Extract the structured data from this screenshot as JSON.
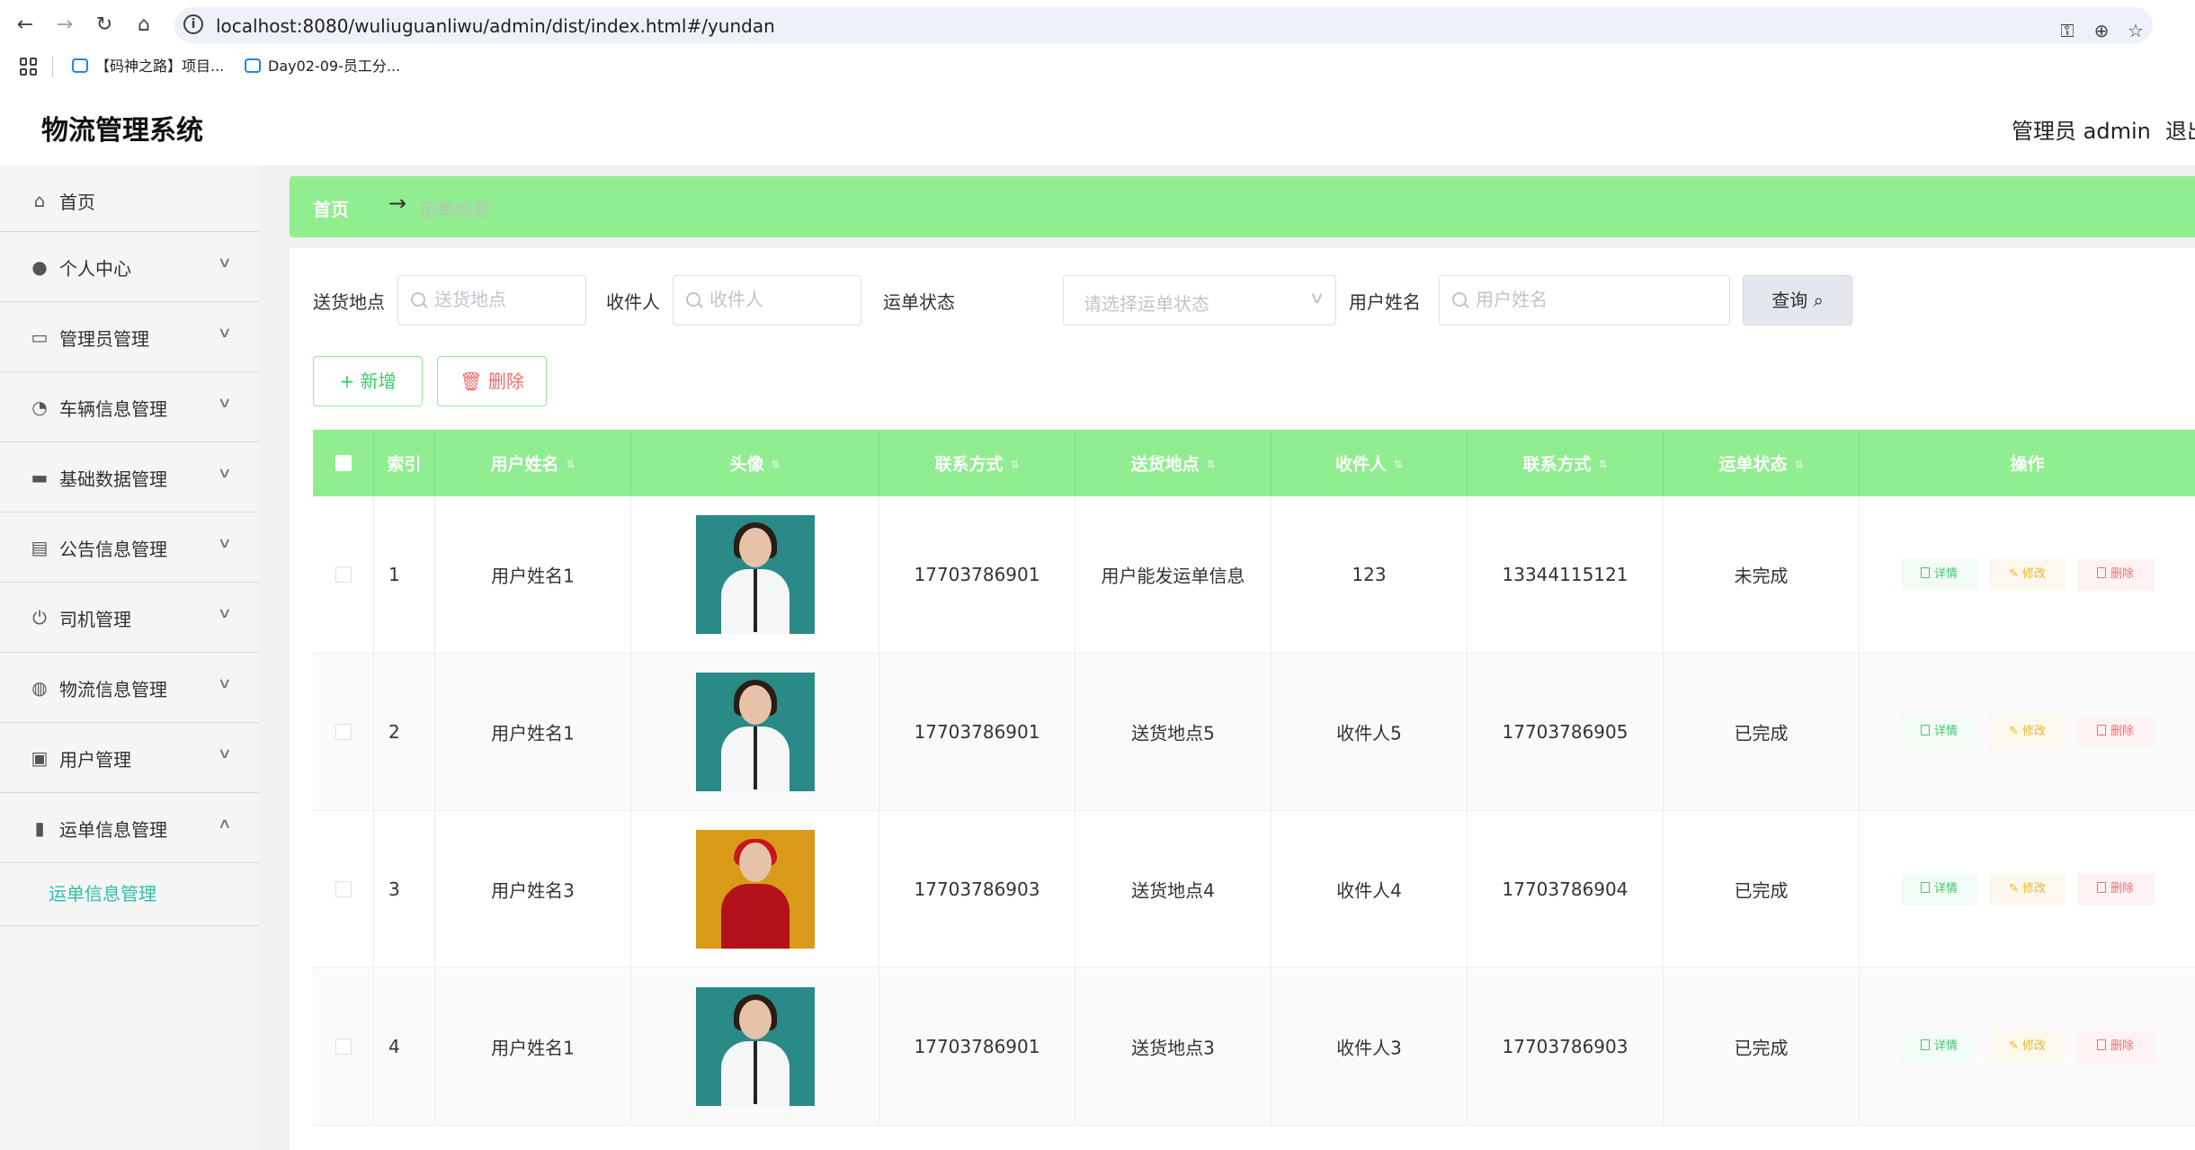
{
  "browser": {
    "url": "localhost:8080/wuliuguanliwu/admin/dist/index.html#/yundan",
    "bookmarks": [
      "【码神之路】项目...",
      "Day02-09-员工分..."
    ]
  },
  "app": {
    "title": "物流管理系统",
    "user": "管理员 admin",
    "logout": "退出"
  },
  "sidebar": {
    "items": [
      {
        "label": "首页",
        "icon": "home-icon"
      },
      {
        "label": "个人中心",
        "icon": "user-icon"
      },
      {
        "label": "管理员管理",
        "icon": "chat-icon"
      },
      {
        "label": "车辆信息管理",
        "icon": "gauge-icon"
      },
      {
        "label": "基础数据管理",
        "icon": "message-icon"
      },
      {
        "label": "公告信息管理",
        "icon": "clipboard-icon"
      },
      {
        "label": "司机管理",
        "icon": "power-icon"
      },
      {
        "label": "物流信息管理",
        "icon": "globe-icon"
      },
      {
        "label": "用户管理",
        "icon": "checklist-icon"
      },
      {
        "label": "运单信息管理",
        "icon": "bar-chart-icon"
      }
    ],
    "submenu": {
      "label": "运单信息管理"
    }
  },
  "breadcrumb": {
    "home": "首页",
    "current": "运单信息"
  },
  "search": {
    "address_label": "送货地点",
    "address_placeholder": "送货地点",
    "recipient_label": "收件人",
    "recipient_placeholder": "收件人",
    "status_label": "运单状态",
    "status_placeholder": "请选择运单状态",
    "username_label": "用户姓名",
    "username_placeholder": "用户姓名",
    "query_label": "查询"
  },
  "actions": {
    "add_label": "新增",
    "delete_label": "删除"
  },
  "table": {
    "columns": [
      "索引",
      "用户姓名",
      "头像",
      "联系方式",
      "送货地点",
      "收件人",
      "联系方式",
      "运单状态",
      "操作"
    ],
    "op_labels": {
      "detail": "详情",
      "edit": "修改",
      "remove": "删除"
    },
    "rows": [
      {
        "index": "1",
        "username": "用户姓名1",
        "phone": "17703786901",
        "address": "用户能发运单信息",
        "recipient": "123",
        "recipient_phone": "13344115121",
        "status": "未完成",
        "avatar": "woman-white-shirt"
      },
      {
        "index": "2",
        "username": "用户姓名1",
        "phone": "17703786901",
        "address": "送货地点5",
        "recipient": "收件人5",
        "recipient_phone": "17703786905",
        "status": "已完成",
        "avatar": "woman-white-shirt"
      },
      {
        "index": "3",
        "username": "用户姓名3",
        "phone": "17703786903",
        "address": "送货地点4",
        "recipient": "收件人4",
        "recipient_phone": "17703786904",
        "status": "已完成",
        "avatar": "woman-red-hat"
      },
      {
        "index": "4",
        "username": "用户姓名1",
        "phone": "17703786901",
        "address": "送货地点3",
        "recipient": "收件人3",
        "recipient_phone": "17703786903",
        "status": "已完成",
        "avatar": "woman-white-shirt"
      }
    ]
  },
  "colors": {
    "accent": "#90ee90",
    "submenu_active": "#2fc0a5",
    "danger": "#f56c6c",
    "warning": "#f0b429"
  }
}
